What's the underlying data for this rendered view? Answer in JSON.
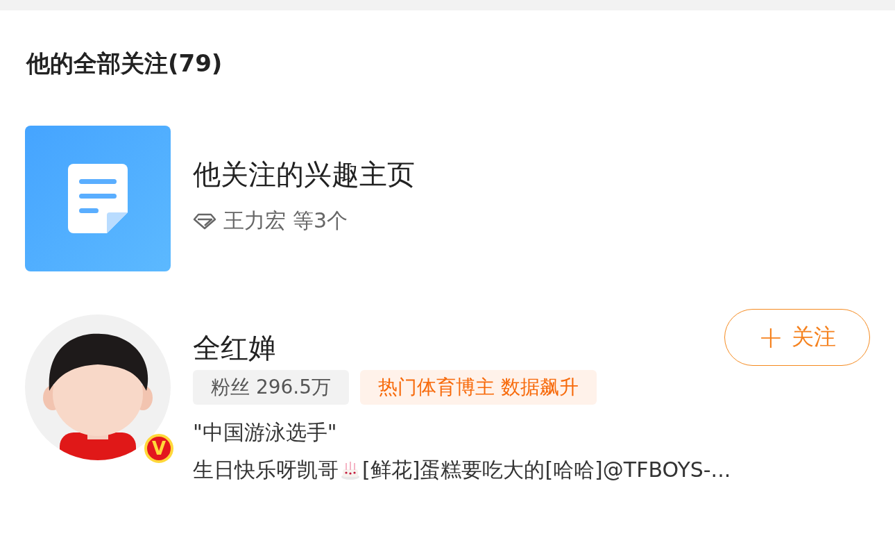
{
  "header": {
    "title": "他的全部关注(79)"
  },
  "interest": {
    "title": "他关注的兴趣主页",
    "names": "王力宏",
    "count": "等3个"
  },
  "user": {
    "verified_badge": "V",
    "name": "全红婵",
    "follow_button": {
      "icon": "+",
      "label": "关注"
    },
    "fans": "粉丝 296.5万",
    "tag": "热门体育博主 数据飙升",
    "bio": "\"中国游泳选手\"",
    "post_before": "生日快乐呀凯哥",
    "post_after": "[鲜花]蛋糕要吃大的[哈哈]@TFBOYS-..."
  }
}
